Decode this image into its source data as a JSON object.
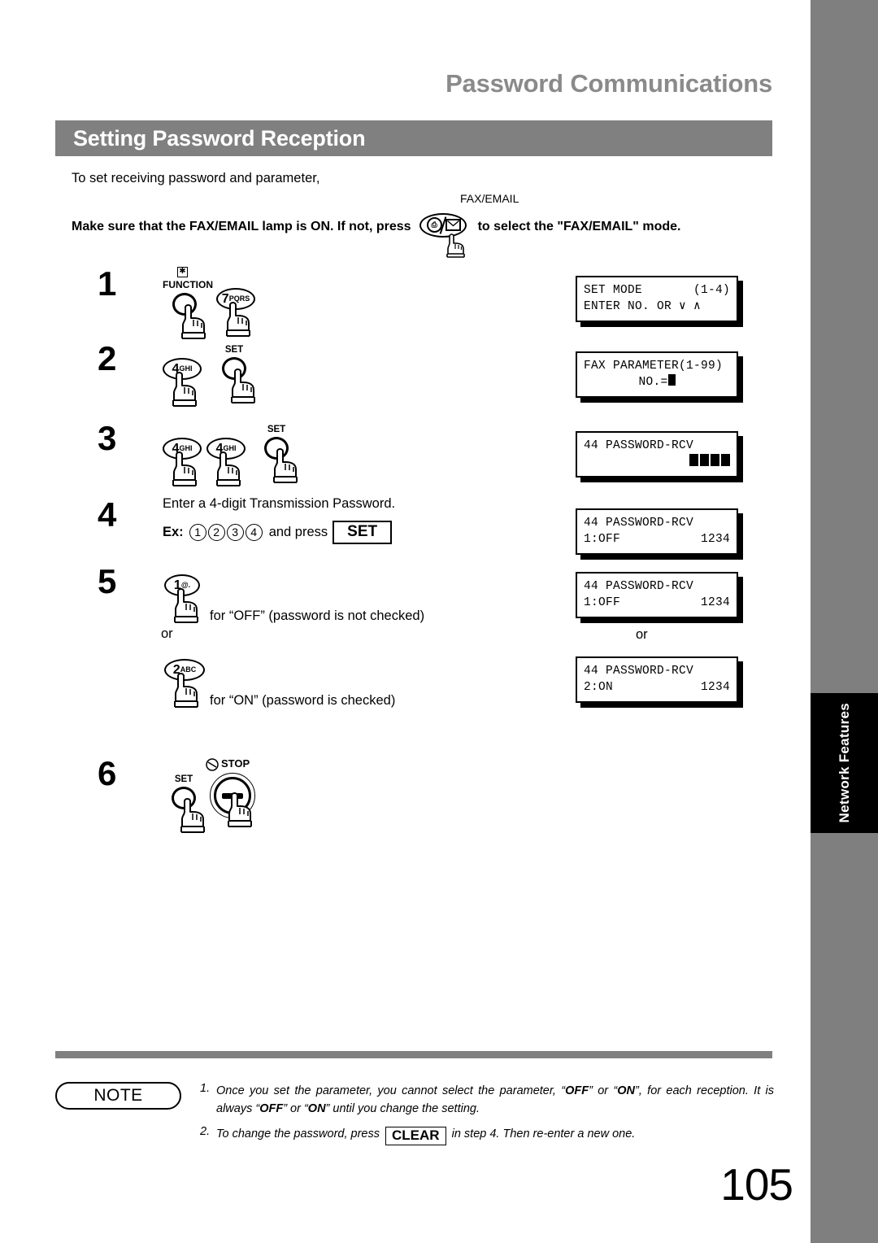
{
  "running_head": "Password Communications",
  "section_title": "Setting Password Reception",
  "intro": {
    "line1": "To set receiving password and parameter,",
    "line2_before": "Make sure that the FAX/EMAIL lamp is ON.  If not, press",
    "line2_after": "to select the \"FAX/EMAIL\" mode.",
    "faxemail_label": "FAX/EMAIL"
  },
  "steps": [
    {
      "number": "1",
      "keys": [
        {
          "type": "circle",
          "caption": "FUNCTION",
          "star": "✱"
        },
        {
          "type": "oval",
          "digit": "7",
          "sub": "PQRS"
        }
      ],
      "lcd": {
        "line1_left": "SET MODE",
        "line1_right": "(1-4)",
        "line2_left": "ENTER NO. OR ∨ ∧"
      }
    },
    {
      "number": "2",
      "keys": [
        {
          "type": "oval",
          "digit": "4",
          "sub": "GHI"
        },
        {
          "type": "circle",
          "caption": "SET"
        }
      ],
      "lcd": {
        "line1_left": "FAX PARAMETER(1-99)",
        "line2_center": "NO.="
      }
    },
    {
      "number": "3",
      "keys": [
        {
          "type": "oval",
          "digit": "4",
          "sub": "GHI"
        },
        {
          "type": "oval",
          "digit": "4",
          "sub": "GHI"
        },
        {
          "type": "circle",
          "caption": "SET"
        }
      ],
      "lcd": {
        "line1_left": "44 PASSWORD-RCV",
        "line2_blocks": 4
      }
    },
    {
      "number": "4",
      "text_line1": "Enter a 4-digit Transmission Password.",
      "ex_label": "Ex:",
      "ex_digits": [
        "1",
        "2",
        "3",
        "4"
      ],
      "ex_mid": "and press",
      "ex_key": "SET",
      "lcd": {
        "line1_left": "44 PASSWORD-RCV",
        "line2_left": "1:OFF",
        "line2_right": "1234"
      }
    },
    {
      "number": "5",
      "option_a": {
        "key": {
          "type": "oval",
          "digit": "1",
          "sub": "@."
        },
        "text": "for “OFF” (password is not checked)",
        "lcd": {
          "line1_left": "44 PASSWORD-RCV",
          "line2_left": "1:OFF",
          "line2_right": "1234"
        }
      },
      "or_left": "or",
      "or_right": "or",
      "option_b": {
        "key": {
          "type": "oval",
          "digit": "2",
          "sub": "ABC"
        },
        "text": "for “ON” (password is checked)",
        "lcd": {
          "line1_left": "44 PASSWORD-RCV",
          "line2_left": "2:ON",
          "line2_right": "1234"
        }
      }
    },
    {
      "number": "6",
      "keys": [
        {
          "type": "circle",
          "caption": "SET"
        },
        {
          "type": "stop",
          "caption": "STOP"
        }
      ]
    }
  ],
  "note": {
    "badge": "NOTE",
    "items": [
      {
        "index": "1.",
        "parts": [
          {
            "t": "Once you set the parameter, you cannot select the parameter, “"
          },
          {
            "t": "OFF",
            "b": true
          },
          {
            "t": "” or “"
          },
          {
            "t": "ON",
            "b": true
          },
          {
            "t": "”, for each reception.  It is always “"
          },
          {
            "t": "OFF",
            "b": true
          },
          {
            "t": "” or “"
          },
          {
            "t": "ON",
            "b": true
          },
          {
            "t": "” until you change the setting."
          }
        ]
      },
      {
        "index": "2.",
        "parts": [
          {
            "t": "To change the password, press "
          },
          {
            "t": "CLEAR",
            "box": true
          },
          {
            "t": " in step 4. Then re-enter a new one."
          }
        ]
      }
    ]
  },
  "side_tab": "Network Features",
  "page_number": "105",
  "colors": {
    "gray_bar": "#808080",
    "running_head": "#8a8a8a",
    "tab_black": "#000000",
    "edge_gray": "#7f7f7f"
  }
}
